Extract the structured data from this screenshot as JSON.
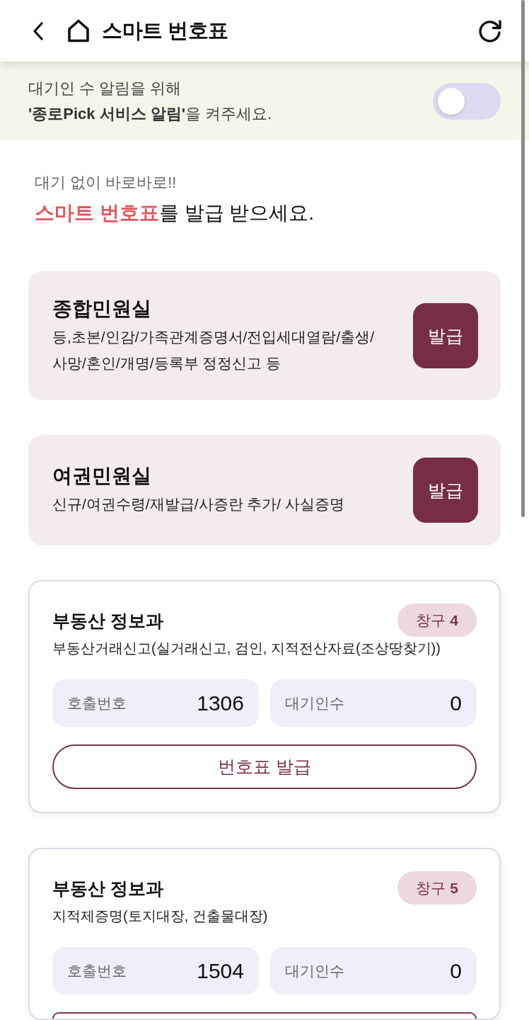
{
  "header": {
    "title": "스마트 번호표"
  },
  "notice": {
    "text": "대기인 수 알림을 위해\n**'종로Pick 서비스 알림'**을 켜주세요.",
    "toggle": {
      "on": false
    }
  },
  "intro": {
    "subtitle": "대기 없이 바로바로!!",
    "headline": "**스마트 번호표**를 발급 받으세요."
  },
  "offices": [
    {
      "name": "종합민원실",
      "description": "등,초본/인감/가족관계증명서/전입세대열람/출생/\n사망/혼인/개명/등록부 정정신고 등",
      "button": "발급"
    },
    {
      "name": "여권민원실",
      "description": "신규/여권수령/재발급/사증란 추가/ 사실증명",
      "button": "발급"
    }
  ],
  "counters": [
    {
      "title": "부동산 정보과",
      "badge": "창구 **4**",
      "description": "부동산거래신고(실거래신고, 검인, 지적전산자료(조상땅찾기))",
      "stats": [
        {
          "label": "호출번호",
          "value": "1306"
        },
        {
          "label": "대기인수",
          "value": "0"
        }
      ],
      "button": {
        "label": "번호표 발급",
        "cut_off": false
      }
    },
    {
      "title": "부동산 정보과",
      "badge": "창구 **5**",
      "description": "지적제증명(토지대장, 건출물대장)",
      "stats": [
        {
          "label": "호출번호",
          "value": "1504"
        },
        {
          "label": "대기인수",
          "value": "0"
        }
      ],
      "button": {
        "cut_off": true
      }
    }
  ]
}
